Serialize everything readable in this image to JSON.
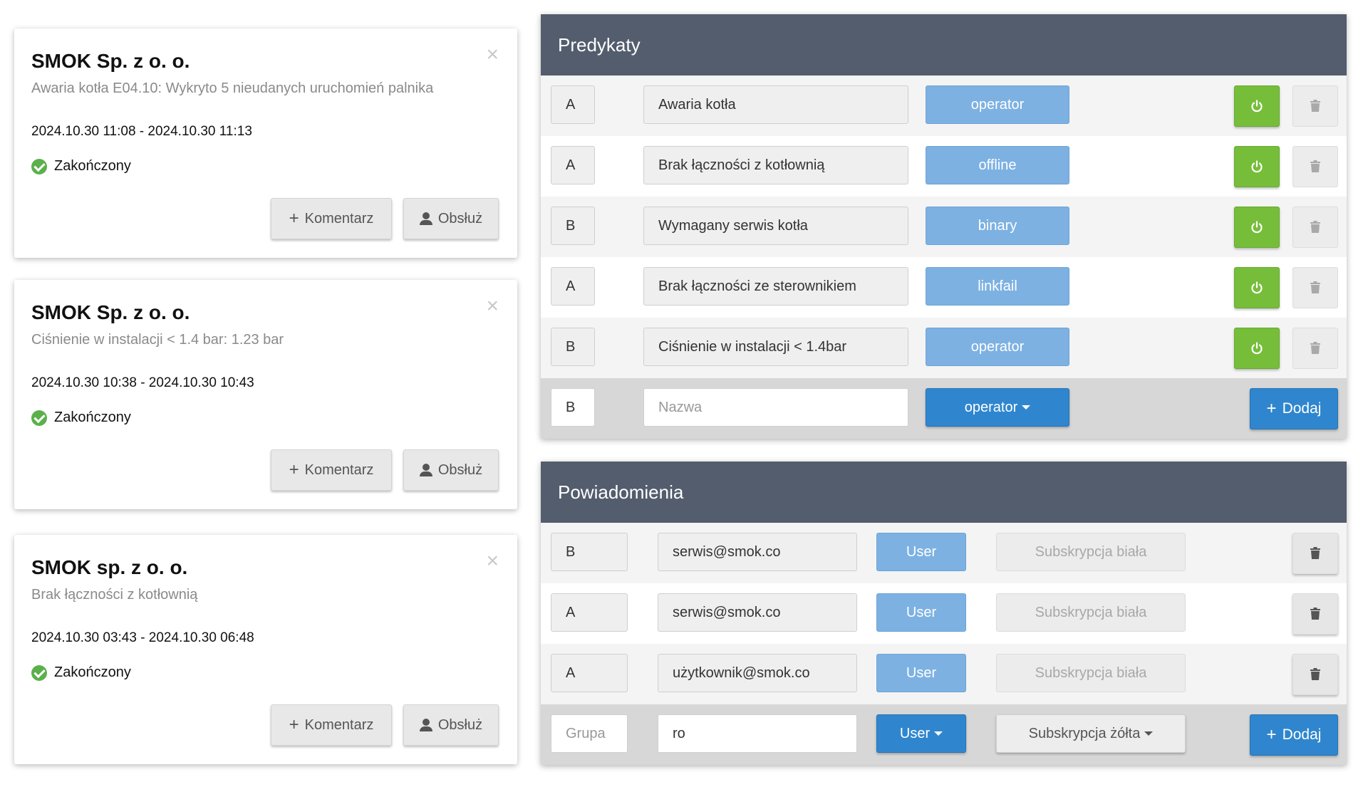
{
  "cards": [
    {
      "title": "SMOK Sp. z o. o.",
      "subtitle": "Awaria kotła E04.10: Wykryto 5 nieudanych uruchomień palnika",
      "time": "2024.10.30 11:08 - 2024.10.30 11:13",
      "status": "Zakończony",
      "comment_label": "Komentarz",
      "handle_label": "Obsłuż"
    },
    {
      "title": "SMOK Sp. z o. o.",
      "subtitle": "Ciśnienie w instalacji < 1.4 bar: 1.23 bar",
      "time": "2024.10.30 10:38 - 2024.10.30 10:43",
      "status": "Zakończony",
      "comment_label": "Komentarz",
      "handle_label": "Obsłuż"
    },
    {
      "title": "SMOK sp. z o. o.",
      "subtitle": "Brak łączności z kotłownią",
      "time": "2024.10.30 03:43 - 2024.10.30 06:48",
      "status": "Zakończony",
      "comment_label": "Komentarz",
      "handle_label": "Obsłuż"
    }
  ],
  "predicates": {
    "title": "Predykaty",
    "rows": [
      {
        "group": "A",
        "name": "Awaria kotła",
        "type": "operator"
      },
      {
        "group": "A",
        "name": "Brak łączności z kotłownią",
        "type": "offline"
      },
      {
        "group": "B",
        "name": "Wymagany serwis kotła",
        "type": "binary"
      },
      {
        "group": "A",
        "name": "Brak łączności ze sterownikiem",
        "type": "linkfail"
      },
      {
        "group": "B",
        "name": "Ciśnienie w instalacji < 1.4bar",
        "type": "operator"
      }
    ],
    "new_row": {
      "group": "B",
      "name_placeholder": "Nazwa",
      "type": "operator",
      "add_label": "Dodaj"
    }
  },
  "notifications": {
    "title": "Powiadomienia",
    "rows": [
      {
        "group": "B",
        "email": "serwis@smok.co",
        "role": "User",
        "subscription": "Subskrypcja biała"
      },
      {
        "group": "A",
        "email": "serwis@smok.co",
        "role": "User",
        "subscription": "Subskrypcja biała"
      },
      {
        "group": "A",
        "email": "użytkownik@smok.co",
        "role": "User",
        "subscription": "Subskrypcja biała"
      }
    ],
    "new_row": {
      "group_placeholder": "Grupa",
      "email": "ro",
      "role": "User",
      "subscription": "Subskrypcja żółta",
      "add_label": "Dodaj"
    }
  },
  "colors": {
    "header": "#535d6d",
    "power_green": "#76be3a",
    "tag_blue": "#7db1e2",
    "primary_blue": "#2f86ce",
    "success_check": "#5bb04b"
  },
  "icons": {
    "close": "close-icon",
    "check": "check-circle-icon",
    "plus": "plus-icon",
    "user": "user-icon",
    "power": "power-icon",
    "trash": "trash-icon",
    "caret": "caret-down-icon"
  }
}
